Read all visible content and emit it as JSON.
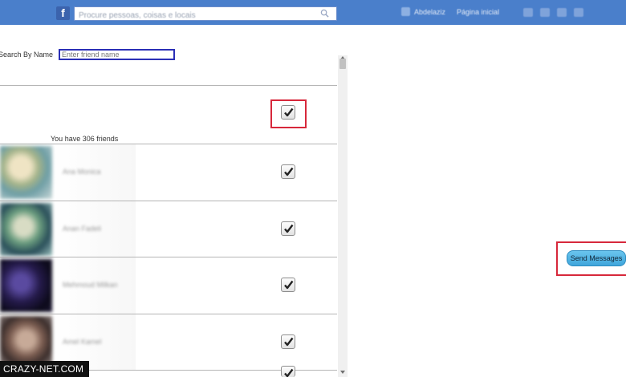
{
  "topbar": {
    "logo": "f",
    "search_placeholder": "Procure pessoas, coisas e locais",
    "profile_name": "Abdelaziz",
    "home_label": "Página inicial",
    "icons": [
      "friend-requests-icon",
      "messages-icon",
      "notifications-icon",
      "settings-icon"
    ]
  },
  "friends_panel": {
    "search_label": "Search By Name",
    "search_placeholder": "Enter friend name",
    "friends_count_text": "You have 306 friends",
    "select_all_checked": true,
    "friends": [
      {
        "name": "Ana Monica",
        "checked": true
      },
      {
        "name": "Anan Fadeli",
        "checked": true
      },
      {
        "name": "Mehmoud Milkan",
        "checked": true
      },
      {
        "name": "Amel Kamel",
        "checked": true
      },
      {
        "name": "",
        "checked": true
      }
    ]
  },
  "actions": {
    "send_label": "Send Messages"
  },
  "watermark": "CRAZY-NET.COM",
  "colors": {
    "topbar": "#4a7fcb",
    "highlight": "#d7283b",
    "send_button": "#4fb3e4"
  }
}
